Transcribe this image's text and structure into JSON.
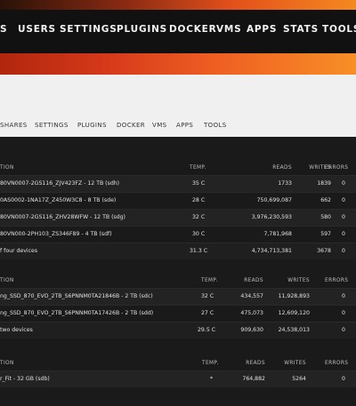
{
  "top_nav": {
    "items": [
      "S",
      "USERS",
      "SETTINGS",
      "PLUGINS",
      "DOCKER",
      "VMS",
      "APPS",
      "STATS",
      "TOOLS"
    ]
  },
  "sub_nav": {
    "items": [
      "SHARES",
      "SETTINGS",
      "PLUGINS",
      "DOCKER",
      "VMS",
      "APPS",
      "TOOLS"
    ]
  },
  "array_table": {
    "headers": {
      "device": "TION",
      "temp": "TEMP.",
      "reads": "READS",
      "writes": "WRITES",
      "errors": "ERRORS"
    },
    "rows": [
      {
        "device": "80VN0007-2GS116_ZJV423FZ - 12 TB (sdh)",
        "temp": "35 C",
        "reads": "1733",
        "writes": "1839",
        "errors": "0"
      },
      {
        "device": "0AS0002-1NA17Z_Z450W3C8 - 8 TB (sde)",
        "temp": "28 C",
        "reads": "750,699,087",
        "writes": "662",
        "errors": "0"
      },
      {
        "device": "80VN0007-2GS116_ZHV28WFW - 12 TB (sdg)",
        "temp": "32 C",
        "reads": "3,976,230,593",
        "writes": "580",
        "errors": "0"
      },
      {
        "device": "80VN000-2PH103_ZS346F89 - 4 TB (sdf)",
        "temp": "30 C",
        "reads": "7,781,968",
        "writes": "597",
        "errors": "0"
      }
    ],
    "total": {
      "device": "f four devices",
      "temp": "31.3 C",
      "reads": "4,734,713,381",
      "writes": "3678",
      "errors": "0"
    }
  },
  "cache_table": {
    "headers": {
      "device": "TION",
      "temp": "TEMP.",
      "reads": "READS",
      "writes": "WRITES",
      "errors": "ERRORS"
    },
    "rows": [
      {
        "device": "ng_SSD_870_EVO_2TB_S6PNNM0TA21846B - 2 TB (sdc)",
        "temp": "32 C",
        "reads": "434,557",
        "writes": "11,928,893",
        "errors": "0"
      },
      {
        "device": "ng_SSD_870_EVO_2TB_S6PNNM0TA17426B - 2 TB (sdd)",
        "temp": "27 C",
        "reads": "475,073",
        "writes": "12,609,120",
        "errors": "0"
      }
    ],
    "total": {
      "device": "two devices",
      "temp": "29.5 C",
      "reads": "909,630",
      "writes": "24,538,013",
      "errors": "0"
    }
  },
  "flash_table": {
    "headers": {
      "device": "TION",
      "temp": "TEMP.",
      "reads": "READS",
      "writes": "WRITES",
      "errors": "ERRORS"
    },
    "rows": [
      {
        "device": "r_Fit - 32 GB (sdb)",
        "temp": "*",
        "reads": "764,882",
        "writes": "5264",
        "errors": "0"
      }
    ]
  }
}
